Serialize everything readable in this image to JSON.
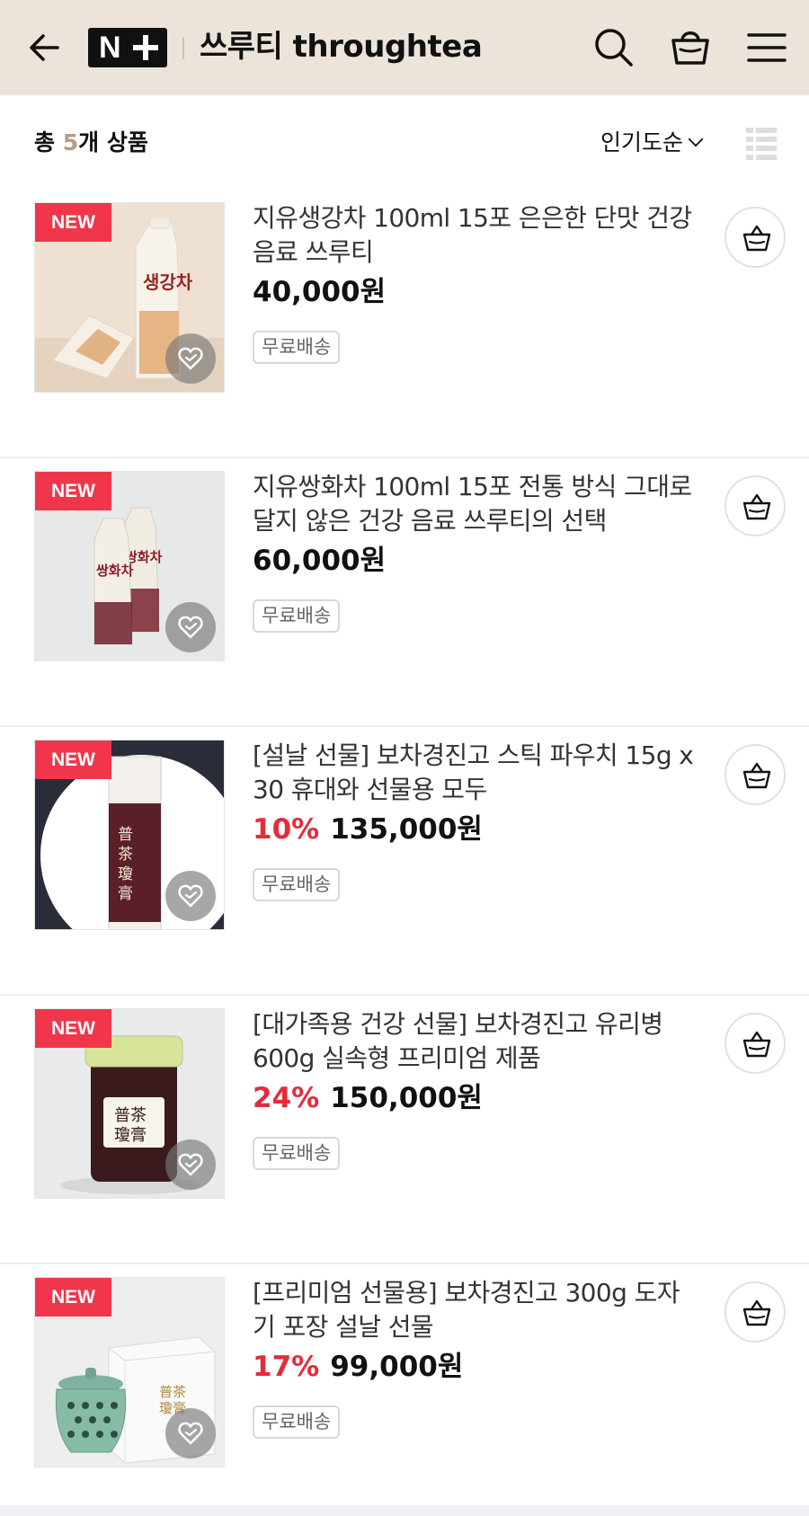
{
  "header": {
    "back_icon": "arrow-left-icon",
    "logo_text": "N",
    "logo_icon": "plus-icon",
    "store_name": "쓰루티 throughtea",
    "icons": [
      "search-icon",
      "shopping-bag-icon",
      "hamburger-menu-icon"
    ]
  },
  "toolbar": {
    "total_prefix": "총 ",
    "total_count": "5",
    "total_suffix": "개 상품",
    "sort_label": "인기도순",
    "view_icon": "list-view-icon"
  },
  "colors": {
    "header_bg": "#ece4da",
    "new_badge": "#f0364a",
    "discount": "#e52b3a",
    "count_accent": "#b79c80"
  },
  "products": [
    {
      "badge": "NEW",
      "title": "지유생강차 100ml 15포 은은한 단맛 건강 음료 쓰루티",
      "discount": "",
      "price": "40,000원",
      "shipping": "무료배송",
      "image": "ginger-tea-pouch"
    },
    {
      "badge": "NEW",
      "title": "지유쌍화차 100ml 15포 전통 방식 그대로 달지 않은 건강 음료 쓰루티의 선택",
      "discount": "",
      "price": "60,000원",
      "shipping": "무료배송",
      "image": "ssanghwa-tea-pouches"
    },
    {
      "badge": "NEW",
      "title": "[설날 선물] 보차경진고 스틱 파우치 15g x 30 휴대와 선물용 모두",
      "discount": "10%",
      "price": "135,000원",
      "shipping": "무료배송",
      "image": "stick-pouch"
    },
    {
      "badge": "NEW",
      "title": "[대가족용 건강 선물] 보차경진고 유리병 600g 실속형 프리미엄 제품",
      "discount": "24%",
      "price": "150,000원",
      "shipping": "무료배송",
      "image": "glass-jar"
    },
    {
      "badge": "NEW",
      "title": "[프리미엄 선물용] 보차경진고 300g 도자기 포장 설날 선물",
      "discount": "17%",
      "price": "99,000원",
      "shipping": "무료배송",
      "image": "ceramic-jar-gift-box"
    }
  ],
  "row_icons": {
    "wishlist": "heart-icon",
    "cart": "shopping-basket-icon"
  }
}
